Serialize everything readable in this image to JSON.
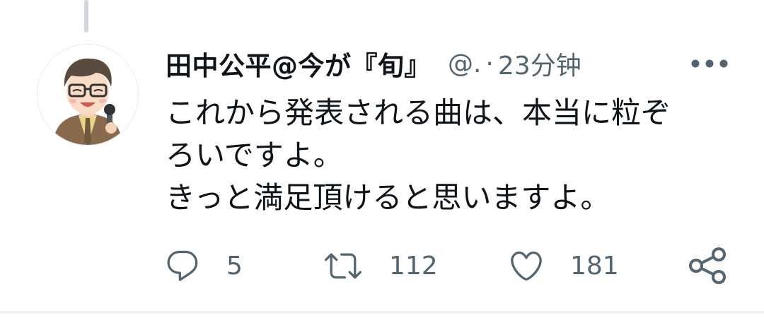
{
  "tweet": {
    "author": {
      "display_name": "田中公平@今が『旬』",
      "handle": "@.",
      "separator": "·",
      "time": "23分钟",
      "avatar_icon": "cartoon-man-glasses-microphone-avatar"
    },
    "text": "これから発表される曲は、本当に粒ぞ\nろいですよ。\nきっと満足頂けると思いますよ。",
    "more_icon": "more-horizontal-icon",
    "actions": {
      "reply": {
        "icon": "reply-icon",
        "count": "5"
      },
      "retweet": {
        "icon": "retweet-icon",
        "count": "112"
      },
      "like": {
        "icon": "heart-icon",
        "count": "181"
      },
      "share": {
        "icon": "share-icon"
      }
    }
  },
  "colors": {
    "text_primary": "#0f1419",
    "text_secondary": "#536471",
    "divider": "#eff3f4",
    "thread_line": "#cfd9de"
  }
}
